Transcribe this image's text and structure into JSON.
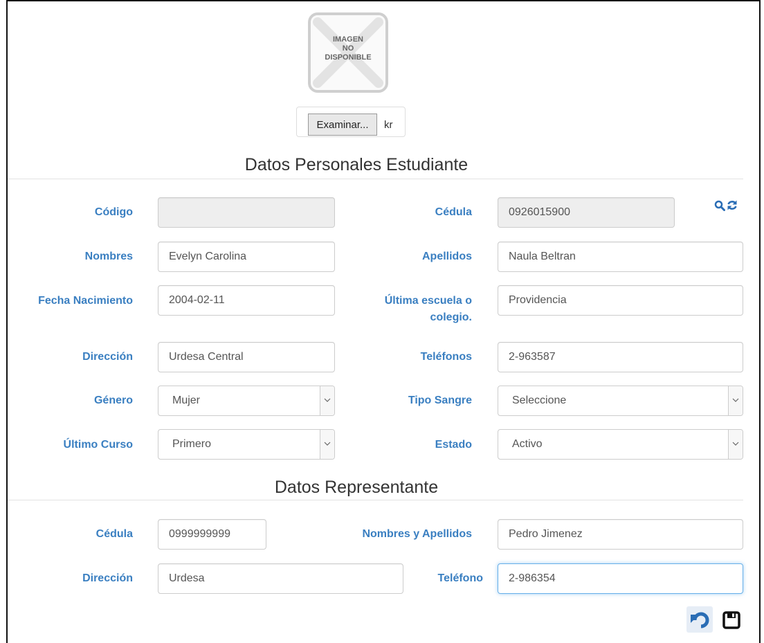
{
  "photo": {
    "line1": "IMAGEN",
    "line2": "NO",
    "line3": "DISPONIBLE"
  },
  "file": {
    "button_label": "Examinar...",
    "file_text": "kr"
  },
  "student_section": {
    "title": "Datos Personales Estudiante",
    "codigo_label": "Código",
    "codigo_value": "",
    "cedula_label": "Cédula",
    "cedula_value": "0926015900",
    "nombres_label": "Nombres",
    "nombres_value": "Evelyn Carolina",
    "apellidos_label": "Apellidos",
    "apellidos_value": "Naula Beltran",
    "fecha_label": "Fecha Nacimiento",
    "fecha_value": "2004-02-11",
    "escuela_label_1": "Última escuela o",
    "escuela_label_2": "colegio.",
    "escuela_value": "Providencia",
    "direccion_label": "Dirección",
    "direccion_value": "Urdesa Central",
    "telefonos_label": "Teléfonos",
    "telefonos_value": "2-963587",
    "genero_label": "Género",
    "genero_value": "Mujer",
    "sangre_label": "Tipo Sangre",
    "sangre_value": "Seleccione",
    "curso_label": "Último Curso",
    "curso_value": "Primero",
    "estado_label": "Estado",
    "estado_value": "Activo"
  },
  "rep_section": {
    "title": "Datos Representante",
    "cedula_label": "Cédula",
    "cedula_value": "0999999999",
    "nombres_label": "Nombres y Apellidos",
    "nombres_value": "Pedro Jimenez",
    "direccion_label": "Dirección",
    "direccion_value": "Urdesa",
    "telefono_label": "Teléfono",
    "telefono_value": "2-986354"
  },
  "icons": {
    "search": "search-icon",
    "refresh": "refresh-icon",
    "undo": "undo-icon",
    "save": "save-icon"
  },
  "colors": {
    "label": "#3a7fc1",
    "icon": "#2a6db5",
    "readonly_bg": "#eeeeee",
    "focus_border": "#66afe9"
  }
}
